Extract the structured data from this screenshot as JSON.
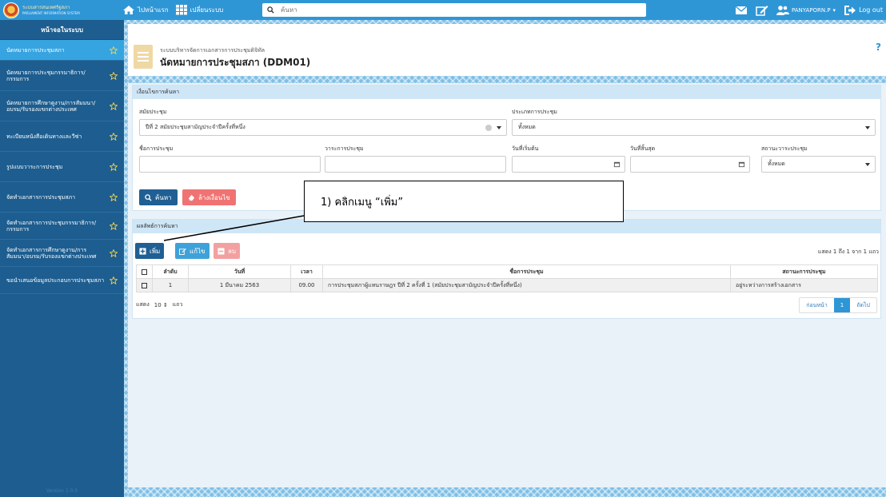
{
  "topbar": {
    "logo_line1": "ระบบสารสนเทศรัฐสภา",
    "logo_line2": "PARLIAMENT INFORMATION SYSTEM",
    "home_label": "ไปหน้าแรก",
    "all_systems_label": "เปลี่ยนระบบ",
    "search_placeholder": "ค้นหา",
    "username": "PANYAPORN.P",
    "logout_label": "Log out"
  },
  "sidebar": {
    "header": "หน้าจอในระบบ",
    "items": [
      {
        "label": "นัดหมายการประชุมสภา",
        "active": true
      },
      {
        "label": "นัดหมายการประชุมกรรมาธิการ/กรรมการ"
      },
      {
        "label": "นัดหมายการศึกษาดูงาน/การสัมมนา/อบรม/รับรองแขกต่างประเทศ"
      },
      {
        "label": "ทะเบียนหนังสือเดินทางและวีซ่า"
      },
      {
        "label": "รูปแบบวาระการประชุม"
      },
      {
        "label": "จัดทำเอกสารการประชุมสภา"
      },
      {
        "label": "จัดทำเอกสารการประชุมกรรมาธิการ/กรรมการ"
      },
      {
        "label": "จัดทำเอกสารการศึกษาดูงาน/การสัมมนา/อบรม/รับรองแขกต่างประเทศ"
      },
      {
        "label": "ขอนำเสนอข้อมูลประกอบการประชุมสภา"
      }
    ],
    "version": "Version 1.0.0"
  },
  "page": {
    "subtitle": "ระบบบริหารจัดการเอกสารการประชุมดิจิทัล",
    "title": "นัดหมายการประชุมสภา (DDM01)",
    "help": "?"
  },
  "search": {
    "header": "เงื่อนไขการค้นหา",
    "session_label": "สมัยประชุม",
    "session_value": "ปีที่ 2 สมัยประชุมสามัญประจำปีครั้งที่หนึ่ง",
    "type_label": "ประเภทการประชุม",
    "type_value": "ทั้งหมด",
    "name_label": "ชื่อการประชุม",
    "agenda_label": "วาระการประชุม",
    "start_label": "วันที่เริ่มต้น",
    "end_label": "วันที่สิ้นสุด",
    "status_label": "สถานะวาระประชุม",
    "status_value": "ทั้งหมด",
    "search_button": "ค้นหา",
    "clear_button": "ล้างเงื่อนไข"
  },
  "callout": {
    "text": "1) คลิกเมนู “เพิ่ม”"
  },
  "results": {
    "header": "ผลลัพธ์การค้นหา",
    "add_button": "เพิ่ม",
    "edit_button": "แก้ไข",
    "delete_button": "ลบ",
    "summary": "แสดง 1 ถึง 1 จาก 1 แถว",
    "columns": [
      "ลำดับ",
      "วันที่",
      "เวลา",
      "ชื่อการประชุม",
      "สถานะการประชุม"
    ],
    "rows": [
      [
        "1",
        "1 มีนาคม 2563",
        "09.00",
        "การประชุมสภาผู้แทนราษฎร ปีที่ 2 ครั้งที่ 1 (สมัยประชุมสามัญประจำปีครั้งที่หนึ่ง)",
        "อยู่ระหว่างการสร้างเอกสาร"
      ]
    ],
    "page_size_prefix": "แสดง",
    "page_size": "10",
    "page_size_suffix": "แถว",
    "prev": "ก่อนหน้า",
    "current_page": "1",
    "next": "ถัดไป"
  }
}
